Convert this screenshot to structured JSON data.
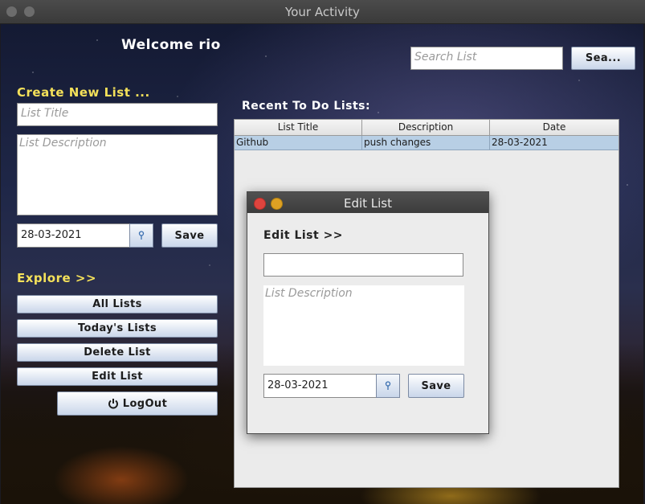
{
  "window": {
    "title": "Your Activity"
  },
  "header": {
    "welcome": "Welcome rio"
  },
  "search": {
    "placeholder": "Search List",
    "button_label": "Sea..."
  },
  "create": {
    "heading": "Create New List ...",
    "title_placeholder": "List Title",
    "description_placeholder": "List Description",
    "date": "28-03-2021",
    "save_label": "Save"
  },
  "explore": {
    "heading": "Explore >>",
    "buttons": [
      "All Lists",
      "Today's Lists",
      "Delete List",
      "Edit List"
    ],
    "logout_label": "LogOut"
  },
  "recent": {
    "heading": "Recent To Do Lists:",
    "columns": [
      "List Title",
      "Description",
      "Date"
    ],
    "rows": [
      {
        "title": "Github",
        "description": "push changes",
        "date": "28-03-2021"
      }
    ]
  },
  "edit_dialog": {
    "title": "Edit List",
    "heading": "Edit List >>",
    "title_value": "",
    "description_placeholder": "List Description",
    "date": "28-03-2021",
    "save_label": "Save"
  },
  "colors": {
    "accent_yellow": "#f4e15a",
    "selection": "#b8cfe5",
    "close": "#e0443e",
    "minimize": "#dea123"
  }
}
